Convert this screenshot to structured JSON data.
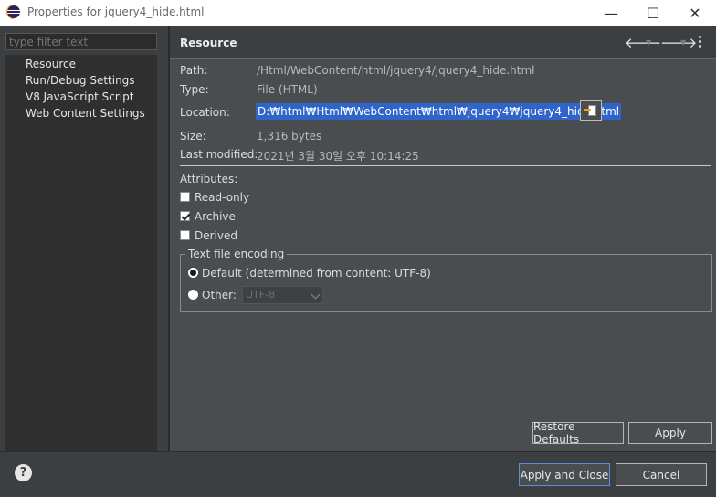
{
  "window": {
    "title": "Properties for jquery4_hide.html",
    "minimize_glyph": "—",
    "maximize_glyph": "☐",
    "close_glyph": "✕"
  },
  "sidebar": {
    "filter_placeholder": "type filter text",
    "items": [
      {
        "label": "Resource",
        "selected": true
      },
      {
        "label": "Run/Debug Settings"
      },
      {
        "label": "V8 JavaScript Script"
      },
      {
        "label": "Web Content Settings"
      }
    ]
  },
  "resource": {
    "title": "Resource",
    "nav": {
      "back_glyph": "🡐",
      "forward_glyph": "🡒",
      "dropdown_glyph": "▼"
    },
    "path": {
      "label": "Path:",
      "value": "/Html/WebContent/html/jquery4/jquery4_hide.html"
    },
    "type": {
      "label": "Type:",
      "value": "File  (HTML)"
    },
    "location": {
      "label": "Location:",
      "value": "D:₩html₩Html₩WebContent₩html₩jquery4₩jquery4_hide.html"
    },
    "size": {
      "label": "Size:",
      "value": "1,316  bytes"
    },
    "last_modified": {
      "label": "Last modified:",
      "value": "2021년 3월 30일 오후 10:14:25"
    },
    "attributes": {
      "label": "Attributes:",
      "read_only": {
        "label": "Read-only",
        "checked": false
      },
      "archive": {
        "label": "Archive",
        "checked": true
      },
      "derived": {
        "label": "Derived",
        "checked": false
      }
    },
    "encoding": {
      "group_label": "Text file encoding",
      "default_option": "Default (determined from content: UTF-8)",
      "other_option": "Other:",
      "other_value": "UTF-8",
      "selected": "default"
    },
    "restore_defaults": "Restore Defaults",
    "apply": "Apply"
  },
  "footer": {
    "help_glyph": "?",
    "apply_and_close": "Apply and Close",
    "cancel": "Cancel"
  },
  "colors": {
    "selection": "#2f65ca",
    "panel": "#4a4d50",
    "background": "#3c3f41"
  }
}
